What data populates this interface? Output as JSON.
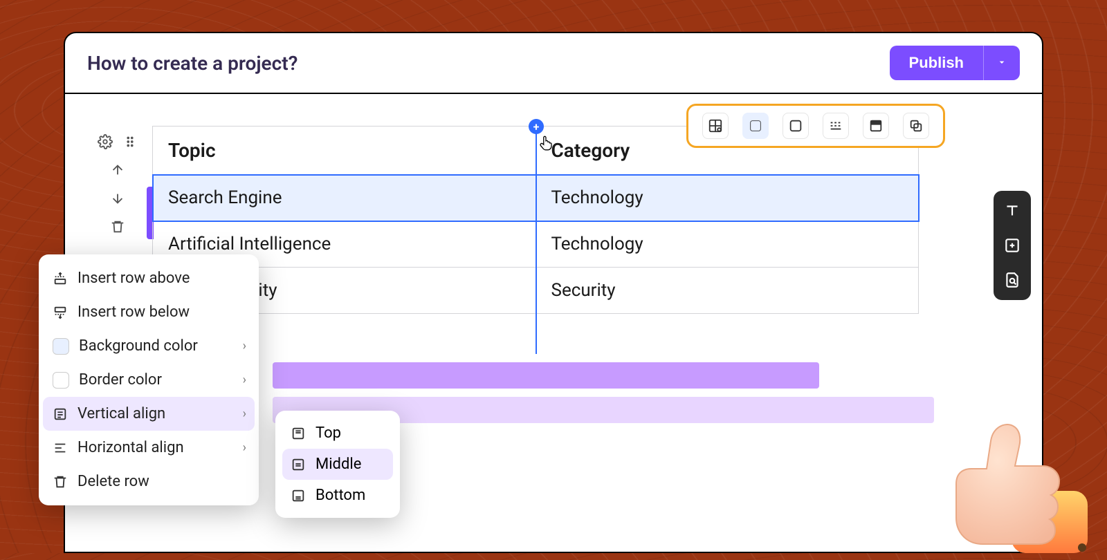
{
  "header": {
    "title": "How to create a project?",
    "publish_label": "Publish"
  },
  "table": {
    "headers": {
      "c0": "Topic",
      "c1": "Category"
    },
    "rows": [
      {
        "c0": "Search Engine",
        "c1": "Technology"
      },
      {
        "c0": "Artificial Intelligence",
        "c1": "Technology"
      },
      {
        "c0": "Cybersecurity",
        "c1": "Security"
      }
    ]
  },
  "context_menu": {
    "insert_above": "Insert row above",
    "insert_below": "Insert row below",
    "bg_color": "Background color",
    "border_color": "Border color",
    "valign": "Vertical align",
    "halign": "Horizontal align",
    "delete": "Delete row"
  },
  "valign_submenu": {
    "top": "Top",
    "middle": "Middle",
    "bottom": "Bottom"
  },
  "colors": {
    "accent": "#7c4dff",
    "selection": "#2f6bff",
    "toolbar_border": "#f5a623"
  }
}
